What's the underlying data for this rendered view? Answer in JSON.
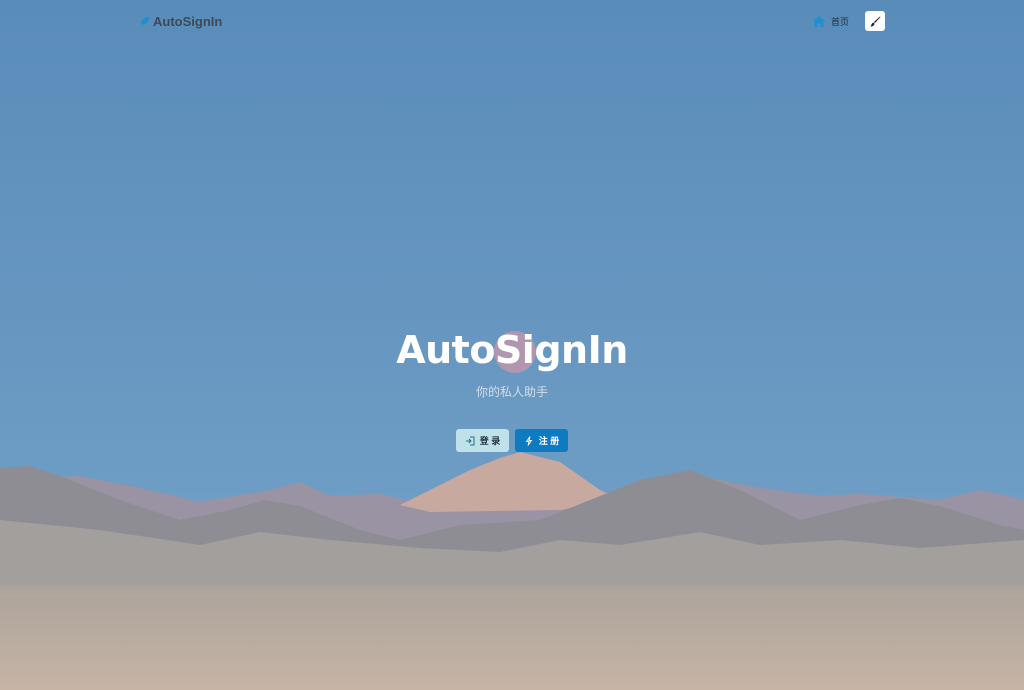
{
  "nav": {
    "brand_name": "AutoSignIn",
    "brand_icon": "rocket-icon",
    "home_label": "首页",
    "home_icon": "home-icon",
    "theme_icon": "paintbrush-icon"
  },
  "hero": {
    "title": "AutoSignIn",
    "subtitle": "你的私人助手",
    "login_label": "登 录",
    "login_icon": "sign-in-icon",
    "register_label": "注 册",
    "register_icon": "lightning-icon"
  },
  "colors": {
    "sky": "#5f8fbb",
    "accent": "#0e7ac2",
    "login_bg": "#bfe2ea"
  }
}
